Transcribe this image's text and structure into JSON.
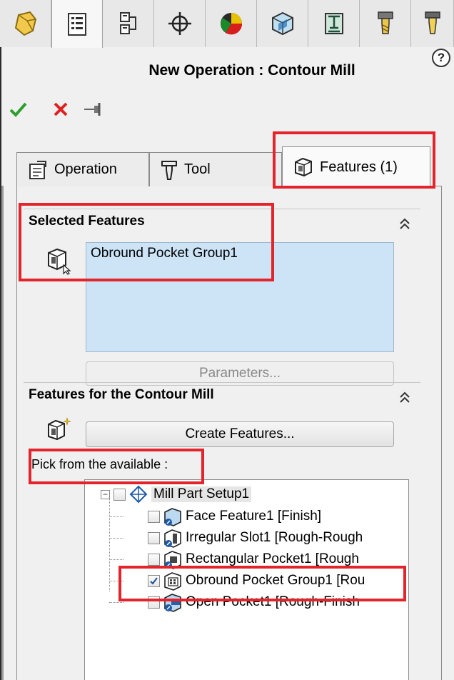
{
  "top_tabs": [
    {
      "icon": "part-manager-icon"
    },
    {
      "icon": "feature-tree-icon"
    },
    {
      "icon": "operation-tree-icon"
    },
    {
      "icon": "coordinate-system-icon"
    },
    {
      "icon": "color-wheel-icon"
    },
    {
      "icon": "stock-icon"
    },
    {
      "icon": "machine-icon"
    },
    {
      "icon": "tool-icon"
    }
  ],
  "help_label": "?",
  "title": "New Operation : Contour Mill",
  "actions": {
    "ok": "ok-check-icon",
    "cancel": "cancel-x-icon",
    "pin": "pin-icon"
  },
  "subtabs": [
    {
      "label": "Operation"
    },
    {
      "label": "Tool"
    },
    {
      "label": "Features (1)"
    }
  ],
  "selected_features": {
    "heading": "Selected Features",
    "items": [
      "Obround Pocket Group1"
    ],
    "parameters_button": "Parameters..."
  },
  "features_for": {
    "heading": "Features for the Contour Mill",
    "create_button": "Create Features...",
    "pick_label": "Pick from the available :",
    "tree_root": "Mill Part Setup1",
    "tree_items": [
      {
        "label": "Face Feature1 [Finish]",
        "checked": false
      },
      {
        "label": "Irregular Slot1 [Rough-Rough",
        "checked": false
      },
      {
        "label": "Rectangular Pocket1 [Rough",
        "checked": false
      },
      {
        "label": "Obround Pocket Group1 [Rou",
        "checked": true
      },
      {
        "label": "Open Pocket1 [Rough-Finish",
        "checked": false
      }
    ]
  },
  "colors": {
    "highlight": "#e3242b",
    "selection": "#cde4f7",
    "ok": "#2e9e2e",
    "cancel": "#e02020"
  }
}
